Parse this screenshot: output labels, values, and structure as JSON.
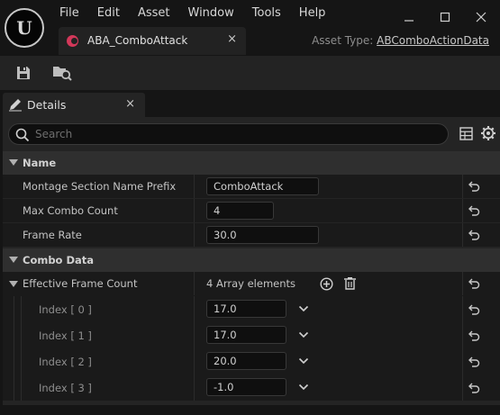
{
  "menu": [
    "File",
    "Edit",
    "Asset",
    "Window",
    "Tools",
    "Help"
  ],
  "app": {
    "logo": "U"
  },
  "document_tab": {
    "label": "ABA_ComboAttack",
    "close": "×"
  },
  "asset_type": {
    "label": "Asset Type:",
    "value": "ABComboActionData"
  },
  "details_tab": {
    "label": "Details",
    "close": "×"
  },
  "search": {
    "placeholder": "Search"
  },
  "categories": {
    "name": "Name",
    "combo_data": "Combo Data"
  },
  "props": {
    "montage_prefix": {
      "label": "Montage Section Name Prefix",
      "value": "ComboAttack"
    },
    "max_combo": {
      "label": "Max Combo Count",
      "value": "4"
    },
    "frame_rate": {
      "label": "Frame Rate",
      "value": "30.0"
    },
    "effective": {
      "label": "Effective Frame Count",
      "count": "4 Array elements"
    }
  },
  "array_items": [
    {
      "label": "Index [ 0 ]",
      "value": "17.0"
    },
    {
      "label": "Index [ 1 ]",
      "value": "17.0"
    },
    {
      "label": "Index [ 2 ]",
      "value": "20.0"
    },
    {
      "label": "Index [ 3 ]",
      "value": "-1.0"
    }
  ],
  "colors": {
    "accent_icon": "#d3385a",
    "panel": "#242424",
    "row": "#1a1a1a",
    "category": "#2f2f2f"
  }
}
